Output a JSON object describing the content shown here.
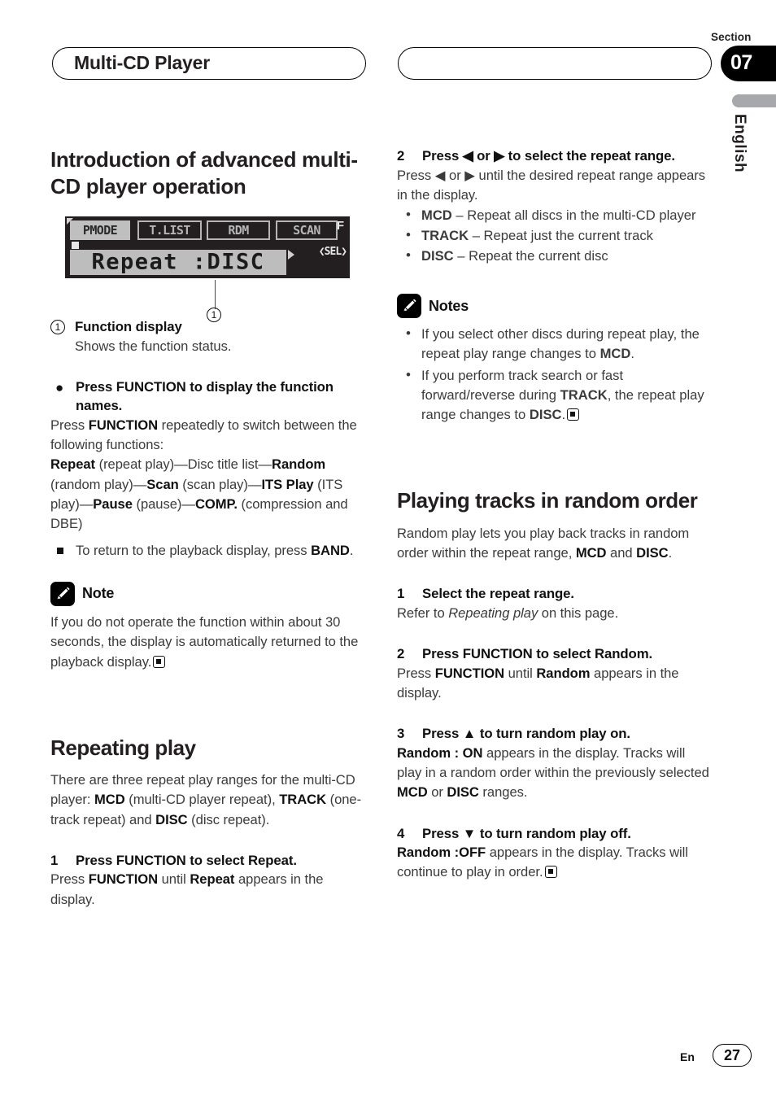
{
  "header": {
    "left_pill_title": "Multi-CD Player",
    "right_pill_title": "",
    "section_label": "Section",
    "section_number": "07",
    "language": "English"
  },
  "footer": {
    "lang_code": "En",
    "page_number": "27"
  },
  "left_column": {
    "heading": "Introduction of advanced multi-CD player operation",
    "lcd": {
      "tag_pmode": "PMODE",
      "tag_tlist": "T.LIST",
      "tag_rdm": "RDM",
      "tag_scan": "SCAN",
      "indicator_f": "F",
      "main_text": "Repeat :DISC",
      "sel_label": "❮SEL❯"
    },
    "callout_number": "1",
    "legend": {
      "number": "1",
      "term": "Function display",
      "description": "Shows the function status."
    },
    "bullet_section": {
      "title": "Press FUNCTION to display the function names.",
      "line1_a": "Press ",
      "line1_b": "FUNCTION",
      "line1_c": " repeatedly to switch between the following functions:",
      "chain": [
        {
          "b": "Repeat",
          "t": " (repeat play)—Disc title list—"
        },
        {
          "b": "Random",
          "t": " (random play)—"
        },
        {
          "b": "Scan",
          "t": " (scan play)—"
        },
        {
          "b": "ITS Play",
          "t": " (ITS play)—"
        },
        {
          "b": "Pause",
          "t": " (pause)—"
        },
        {
          "b": "COMP.",
          "t": " (compression and DBE)"
        }
      ],
      "sub_bullet_a": "To return to the playback display, press ",
      "sub_bullet_b": "BAND",
      "sub_bullet_c": "."
    },
    "note": {
      "label": "Note",
      "text": "If you do not operate the function within about 30 seconds, the display is automatically returned to the playback display."
    },
    "repeating": {
      "heading": "Repeating play",
      "intro_1": "There are three repeat play ranges for the multi-CD player: ",
      "intro_b1": "MCD",
      "intro_2": " (multi-CD player repeat), ",
      "intro_b2": "TRACK",
      "intro_3": " (one-track repeat) and ",
      "intro_b3": "DISC",
      "intro_4": " (disc repeat).",
      "step1_num": "1",
      "step1_title": "Press FUNCTION to select Repeat.",
      "step1_a": "Press ",
      "step1_b": "FUNCTION",
      "step1_c": " until ",
      "step1_d": "Repeat",
      "step1_e": " appears in the display."
    }
  },
  "right_column": {
    "step2": {
      "num": "2",
      "title": "Press ◀ or ▶ to select the repeat range.",
      "body_a": "Press ",
      "body_b": "◀",
      "body_c": " or ",
      "body_d": "▶",
      "body_e": " until the desired repeat range appears in the display.",
      "options": [
        {
          "term": "MCD",
          "desc": " – Repeat all discs in the multi-CD player"
        },
        {
          "term": "TRACK",
          "desc": " – Repeat just the current track"
        },
        {
          "term": "DISC",
          "desc": " – Repeat the current disc"
        }
      ]
    },
    "notes": {
      "label": "Notes",
      "items": [
        {
          "a": "If you select other discs during repeat play, the repeat play range changes to ",
          "b": "MCD",
          "c": "."
        },
        {
          "a": "If you perform track search or fast forward/reverse during ",
          "b": "TRACK",
          "c": ", the repeat play range changes to ",
          "d": "DISC",
          "e": "."
        }
      ]
    },
    "random": {
      "heading": "Playing tracks in random order",
      "intro_a": "Random play lets you play back tracks in random order within the repeat range, ",
      "intro_b": "MCD",
      "intro_c": " and ",
      "intro_d": "DISC",
      "intro_e": ".",
      "step1_num": "1",
      "step1_title": "Select the repeat range.",
      "step1_a": "Refer to ",
      "step1_i": "Repeating play",
      "step1_b": " on this page.",
      "step2_num": "2",
      "step2_title": "Press FUNCTION to select Random.",
      "step2_a": "Press ",
      "step2_b": "FUNCTION",
      "step2_c": " until ",
      "step2_d": "Random",
      "step2_e": " appears in the display.",
      "step3_num": "3",
      "step3_title": "Press ▲ to turn random play on.",
      "step3_b": "Random : ON",
      "step3_a": " appears in the display. Tracks will play in a random order within the previously selected ",
      "step3_b2": "MCD",
      "step3_c": " or ",
      "step3_d": "DISC",
      "step3_e": " ranges.",
      "step4_num": "4",
      "step4_title": "Press ▼ to turn random play off.",
      "step4_b": "Random :OFF",
      "step4_a": " appears in the display. Tracks will continue to play in order."
    }
  }
}
